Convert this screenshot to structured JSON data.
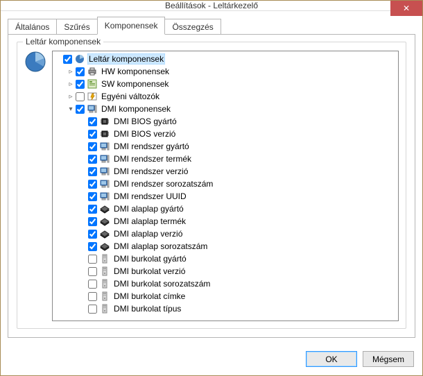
{
  "window": {
    "title": "Beállítások - Leltárkezelő",
    "close_glyph": "✕"
  },
  "tabs": {
    "general": "Általános",
    "filter": "Szűrés",
    "components": "Komponensek",
    "summary": "Összegzés",
    "active": "components"
  },
  "group": {
    "label": "Leltár komponensek"
  },
  "tree": {
    "root": {
      "label": "Leltár komponensek",
      "checked": true,
      "icon": "chart-icon",
      "selected": true
    },
    "hw": {
      "label": "HW komponensek",
      "checked": true,
      "icon": "printer-icon",
      "expander": "closed"
    },
    "sw": {
      "label": "SW komponensek",
      "checked": true,
      "icon": "software-icon",
      "expander": "closed"
    },
    "custom": {
      "label": "Egyéni változók",
      "checked": false,
      "icon": "lightning-icon",
      "expander": "closed"
    },
    "dmi": {
      "label": "DMI komponensek",
      "checked": true,
      "icon": "computer-icon",
      "expander": "open"
    },
    "dmi_items": [
      {
        "label": "DMI BIOS gyártó",
        "checked": true,
        "icon": "chip-icon"
      },
      {
        "label": "DMI BIOS verzió",
        "checked": true,
        "icon": "chip-icon"
      },
      {
        "label": "DMI rendszer gyártó",
        "checked": true,
        "icon": "computer-icon"
      },
      {
        "label": "DMI rendszer termék",
        "checked": true,
        "icon": "computer-icon"
      },
      {
        "label": "DMI rendszer verzió",
        "checked": true,
        "icon": "computer-icon"
      },
      {
        "label": "DMI rendszer sorozatszám",
        "checked": true,
        "icon": "computer-icon"
      },
      {
        "label": "DMI rendszer UUID",
        "checked": true,
        "icon": "computer-icon"
      },
      {
        "label": "DMI alaplap gyártó",
        "checked": true,
        "icon": "board-icon"
      },
      {
        "label": "DMI alaplap termék",
        "checked": true,
        "icon": "board-icon"
      },
      {
        "label": "DMI alaplap verzió",
        "checked": true,
        "icon": "board-icon"
      },
      {
        "label": "DMI alaplap sorozatszám",
        "checked": true,
        "icon": "board-icon"
      },
      {
        "label": "DMI burkolat gyártó",
        "checked": false,
        "icon": "case-icon"
      },
      {
        "label": "DMI burkolat verzió",
        "checked": false,
        "icon": "case-icon"
      },
      {
        "label": "DMI burkolat sorozatszám",
        "checked": false,
        "icon": "case-icon"
      },
      {
        "label": "DMI burkolat címke",
        "checked": false,
        "icon": "case-icon"
      },
      {
        "label": "DMI burkolat típus",
        "checked": false,
        "icon": "case-icon"
      }
    ]
  },
  "buttons": {
    "ok": "OK",
    "cancel": "Mégsem"
  },
  "icons": {
    "chart-icon": "svg-pie-small",
    "printer-icon": "🖶",
    "software-icon": "svg-sw",
    "lightning-icon": "svg-lightning",
    "computer-icon": "svg-computer",
    "chip-icon": "svg-chip",
    "board-icon": "svg-board",
    "case-icon": "svg-case"
  }
}
